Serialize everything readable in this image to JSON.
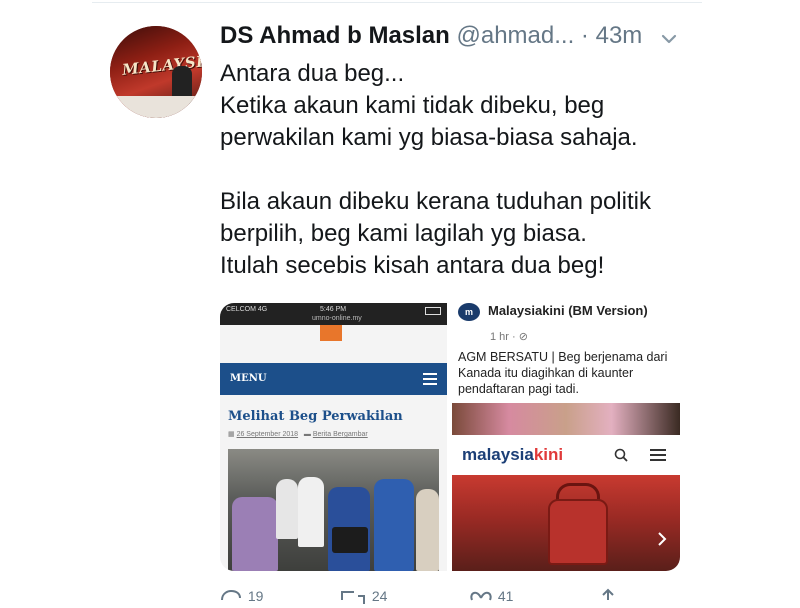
{
  "tweet": {
    "author_name": "DS Ahmad b Maslan",
    "handle": "@ahmad...",
    "separator": "·",
    "time": "43m",
    "text": "Antara dua beg...\nKetika akaun kami tidak dibeku, beg\nperwakilan kami yg biasa-biasa sahaja.\n\nBila akaun dibeku kerana tuduhan politik\nberpilih, beg kami lagilah yg biasa.\nItulah secebis kisah antara dua beg!",
    "avatar_logo_text": "MALAYSIA"
  },
  "media_left": {
    "carrier": "CELCOM 4G",
    "clock": "5:46 PM",
    "url": "umno-online.my",
    "menu_label": "MENU",
    "article_title": "Melihat Beg Perwakilan",
    "date": "26 September 2018",
    "category": "Berita Bergambar"
  },
  "media_right": {
    "source_logo": "m",
    "source_name": "Malaysiakini (BM Version)",
    "post_time": "1 hr · ",
    "caption": "AGM BERSATU | Beg berjenama dari Kanada itu diagihkan di kaunter pendaftaran pagi tadi.",
    "brand_main": "malaysia",
    "brand_accent": "kini"
  },
  "actions": {
    "replies": "19",
    "retweets": "24",
    "likes": "41"
  },
  "colors": {
    "name_text": "#14171a",
    "meta_text": "#657786",
    "umno_menu": "#1c4f8a",
    "mkini_brand_blue": "#1c3f77",
    "mkini_brand_red": "#e03a3a"
  },
  "icons": [
    "chevron-down-icon",
    "hamburger-icon",
    "search-icon",
    "reply-icon",
    "retweet-icon",
    "like-icon",
    "share-icon",
    "next-arrow-icon"
  ]
}
